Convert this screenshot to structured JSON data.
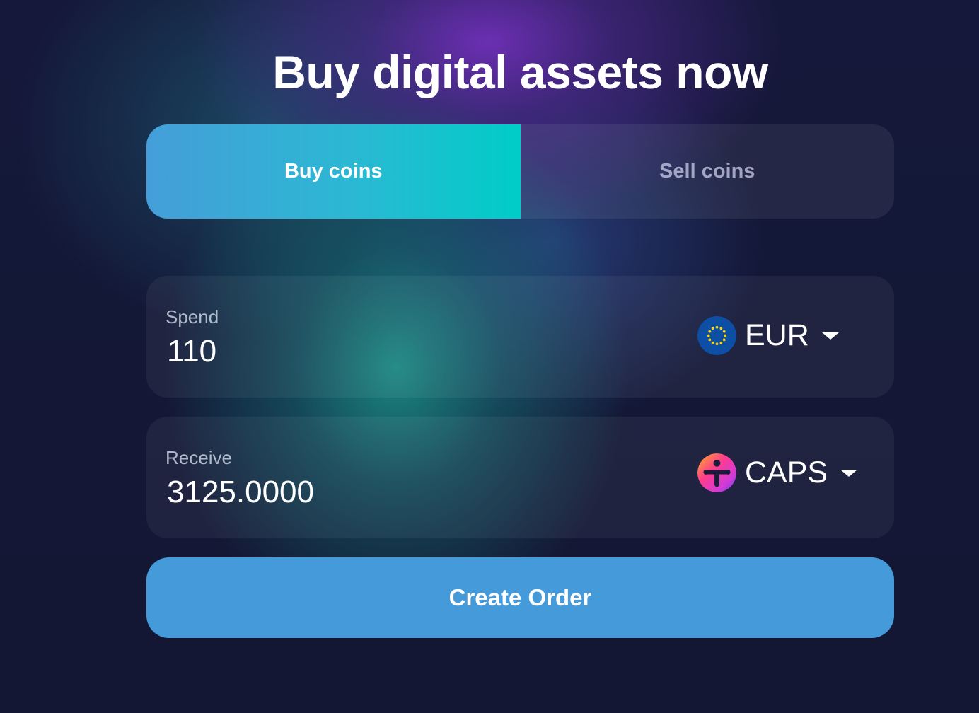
{
  "header": {
    "title": "Buy digital assets now"
  },
  "tabs": [
    {
      "label": "Buy coins",
      "active": true
    },
    {
      "label": "Sell coins",
      "active": false
    }
  ],
  "spend": {
    "label": "Spend",
    "value": "110",
    "currency": {
      "code": "EUR",
      "icon": "eu-flag-icon"
    }
  },
  "receive": {
    "label": "Receive",
    "value": "3125.0000",
    "currency": {
      "code": "CAPS",
      "icon": "caps-token-icon"
    }
  },
  "action": {
    "label": "Create Order"
  },
  "colors": {
    "background": "#131733",
    "active_tab_start": "#459ed9",
    "active_tab_end": "#00cdc8",
    "button": "#459ad9",
    "text": "#ffffff"
  }
}
